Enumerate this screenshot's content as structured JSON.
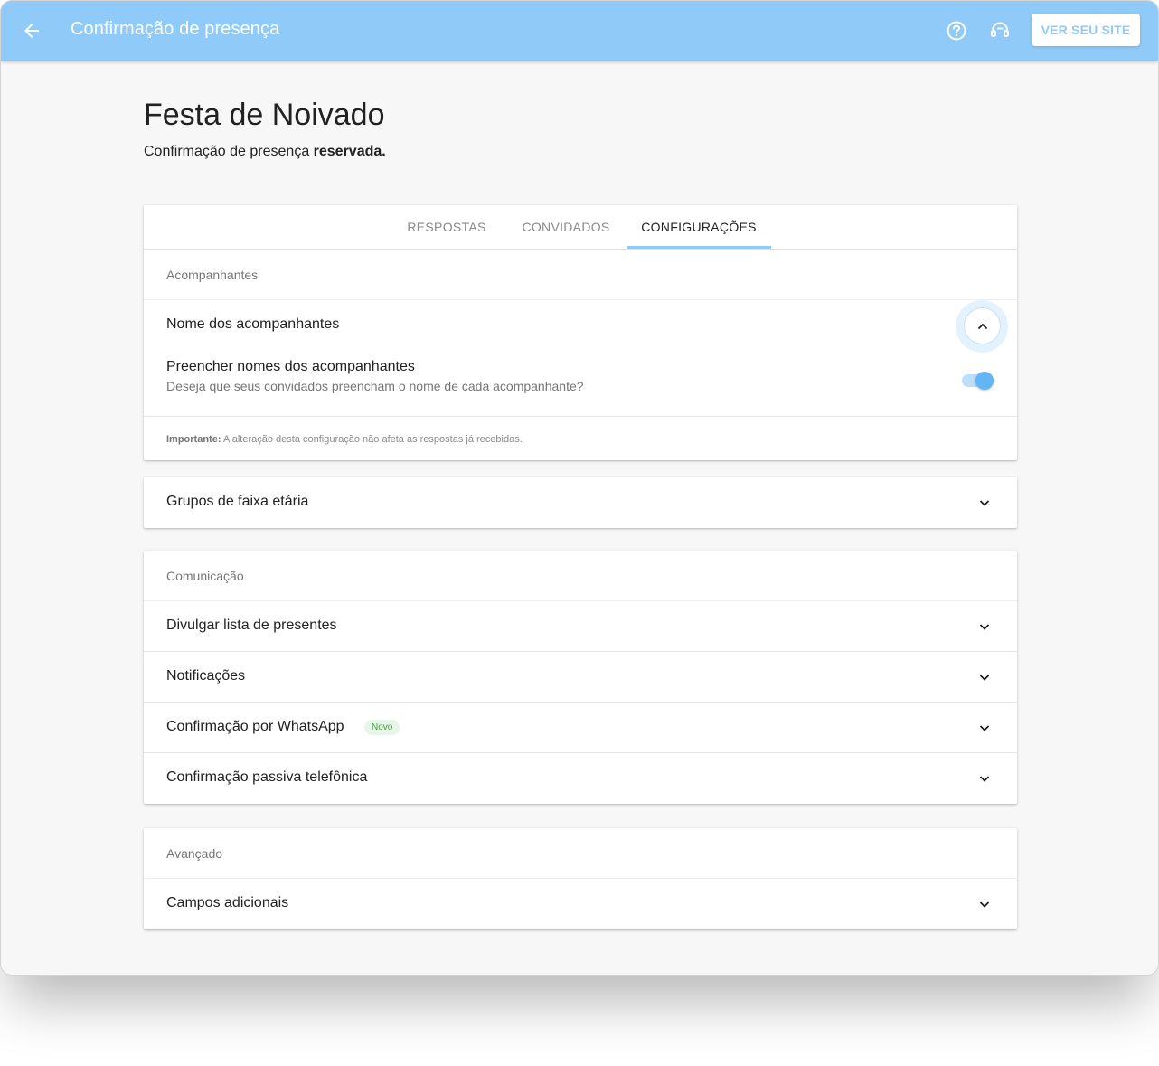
{
  "topbar": {
    "title": "Confirmação de presença",
    "site_button": "VER SEU SITE",
    "color": "#90caf9"
  },
  "page": {
    "title": "Festa de Noivado",
    "subtitle_prefix": "Confirmação de presença ",
    "subtitle_bold": "reservada."
  },
  "tabs": [
    {
      "label": "RESPOSTAS",
      "active": false
    },
    {
      "label": "CONVIDADOS",
      "active": false
    },
    {
      "label": "CONFIGURAÇÕES",
      "active": true
    }
  ],
  "acompanhantes": {
    "header": "Acompanhantes",
    "row_label": "Nome dos acompanhantes",
    "setting_title": "Preencher nomes dos acompanhantes",
    "setting_desc": "Deseja que seus convidados preencham o nome de cada acompanhante?",
    "toggle_on": true,
    "note_bold": "Importante:",
    "note_text": " A alteração desta configuração não afeta as respostas já recebidas."
  },
  "faixa_etaria": {
    "row_label": "Grupos de faixa etária"
  },
  "comunicacao": {
    "header": "Comunicação",
    "rows": [
      {
        "label": "Divulgar lista de presentes"
      },
      {
        "label": "Notificações"
      },
      {
        "label": "Confirmação por WhatsApp",
        "badge": "Novo"
      },
      {
        "label": "Confirmação passiva telefônica"
      }
    ]
  },
  "avancado": {
    "header": "Avançado",
    "rows": [
      {
        "label": "Campos adicionais"
      }
    ]
  },
  "icons": {
    "back": "arrow-left-icon",
    "help": "help-circle-icon",
    "support": "headset-icon",
    "expand": "chevron-up-icon",
    "collapse": "chevron-down-icon"
  }
}
